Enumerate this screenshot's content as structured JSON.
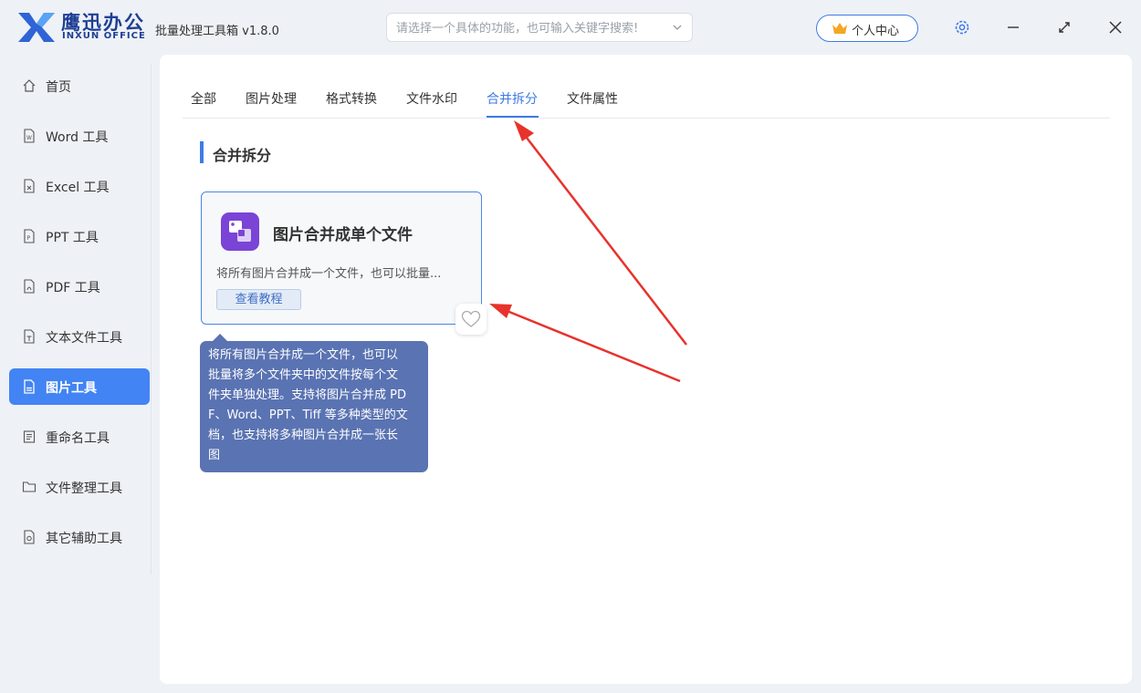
{
  "header": {
    "logo_cn": "鹰迅办公",
    "logo_en": "INXUN OFFICE",
    "app_title": "批量处理工具箱 v1.8.0",
    "search_placeholder": "请选择一个具体的功能，也可输入关键字搜索!",
    "user_center": "个人中心"
  },
  "sidebar": {
    "items": [
      {
        "label": "首页",
        "icon": "home-icon"
      },
      {
        "label": "Word 工具",
        "icon": "word-file-icon"
      },
      {
        "label": "Excel 工具",
        "icon": "excel-file-icon"
      },
      {
        "label": "PPT 工具",
        "icon": "ppt-file-icon"
      },
      {
        "label": "PDF 工具",
        "icon": "pdf-file-icon"
      },
      {
        "label": "文本文件工具",
        "icon": "text-file-icon"
      },
      {
        "label": "图片工具",
        "icon": "image-file-icon",
        "active": true
      },
      {
        "label": "重命名工具",
        "icon": "rename-icon"
      },
      {
        "label": "文件整理工具",
        "icon": "folder-icon"
      },
      {
        "label": "其它辅助工具",
        "icon": "tools-icon"
      }
    ]
  },
  "tabs": [
    {
      "label": "全部"
    },
    {
      "label": "图片处理"
    },
    {
      "label": "格式转换"
    },
    {
      "label": "文件水印"
    },
    {
      "label": "合并拆分",
      "active": true
    },
    {
      "label": "文件属性"
    }
  ],
  "section": {
    "title": "合并拆分"
  },
  "card": {
    "title": "图片合并成单个文件",
    "description": "将所有图片合并成一个文件，也可以批量...",
    "tutorial_label": "查看教程"
  },
  "tooltip": {
    "lines": [
      "将所有图片合并成一个文件，也可以",
      "批量将多个文件夹中的文件按每个文",
      "件夹单独处理。支持将图片合并成 PD",
      "F、Word、PPT、Tiff 等多种类型的文",
      "档，也支持将多种图片合并成一张长",
      "图"
    ]
  },
  "colors": {
    "accent": "#4284f3",
    "tooltip_bg": "#5a73b2",
    "annotation_arrow": "#e8322b",
    "card_icon": "#7a44d6"
  }
}
